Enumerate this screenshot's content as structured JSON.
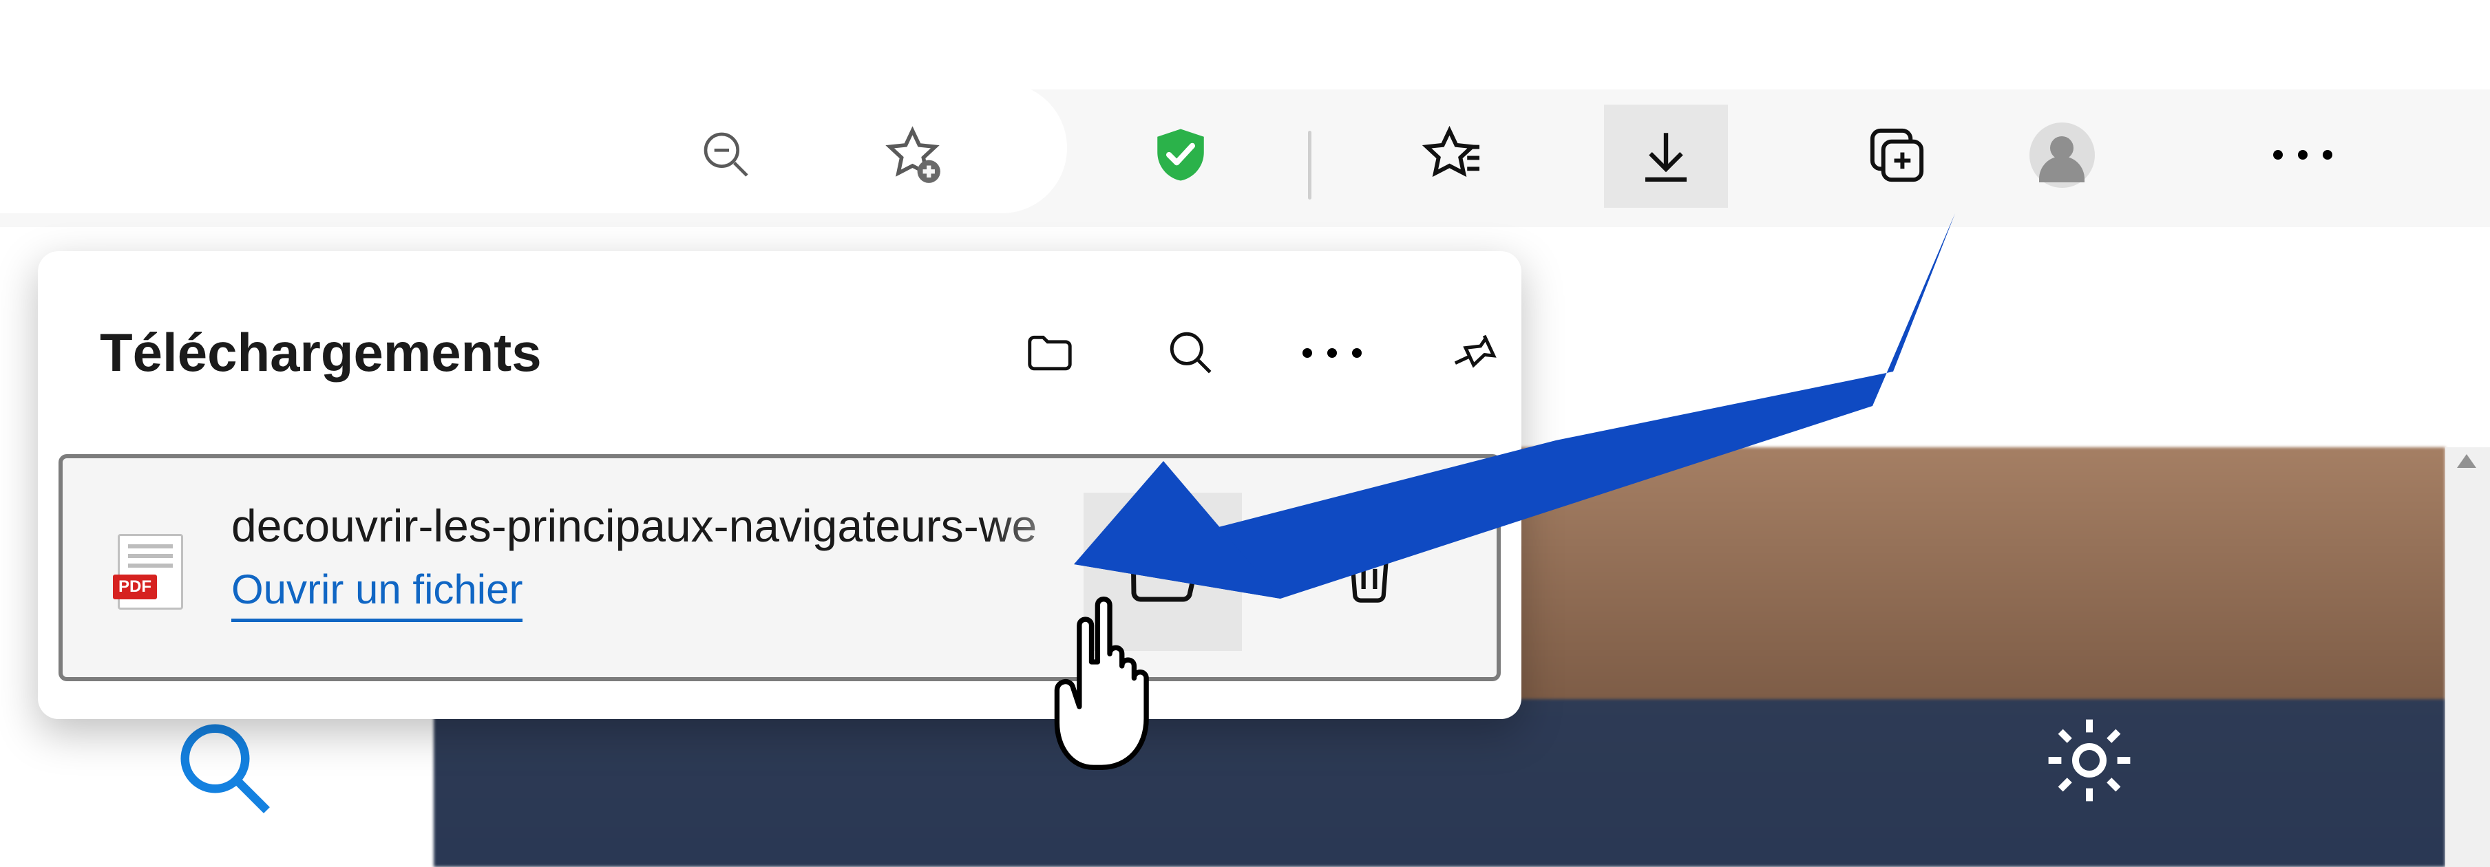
{
  "toolbar": {
    "zoom_icon": "zoom-out",
    "add_favorite_icon": "star-add",
    "extension_shield_icon": "shield-check",
    "favorites_icon": "favorites-list",
    "downloads_icon": "download",
    "collections_icon": "collections-add",
    "profile_icon": "profile",
    "menu_icon": "more"
  },
  "downloads_panel": {
    "title": "Téléchargements",
    "header_icons": {
      "folder": "open-downloads-folder",
      "search": "search-downloads",
      "more": "downloads-more",
      "pin": "pin-panel"
    },
    "item": {
      "file_name": "decouvrir-les-principaux-navigateurs-we",
      "file_type_badge": "PDF",
      "open_link": "Ouvrir un fichier",
      "action_open_folder": "show-in-folder",
      "action_delete": "delete-download"
    }
  },
  "content": {
    "search_icon": "content-search",
    "settings_icon": "content-settings"
  },
  "annotation": {
    "arrow_color": "#0f4ac2",
    "cursor": "hand-pointer"
  }
}
